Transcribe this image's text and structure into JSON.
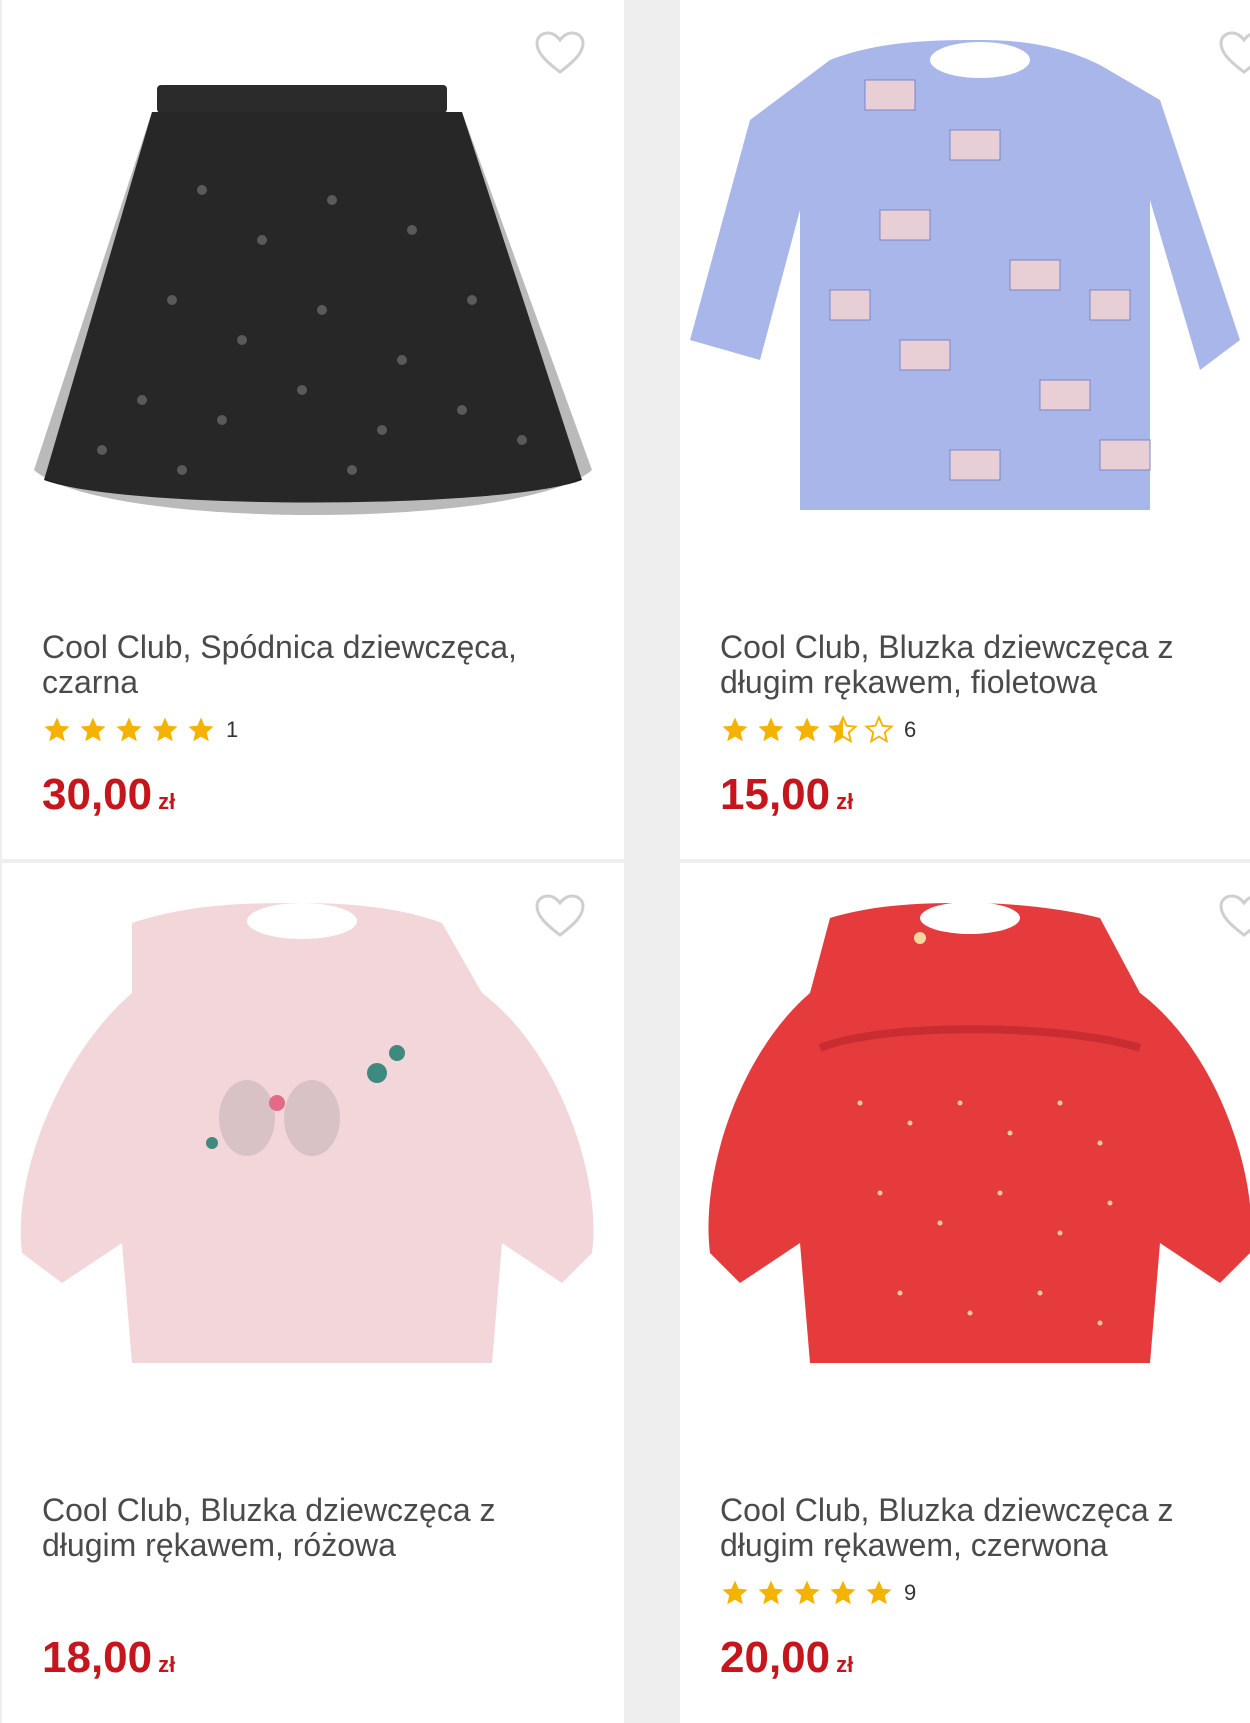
{
  "products": [
    {
      "title": "Cool Club, Spódnica dziewczęca, czarna",
      "stars": [
        1,
        1,
        1,
        1,
        1
      ],
      "rating_count": "1",
      "price": "30,00",
      "currency": "zł",
      "image_icon": "black-tulle-skirt-image"
    },
    {
      "title": "Cool Club, Bluzka dziewczęca z długim rękawem, fioletowa",
      "stars": [
        1,
        1,
        1,
        0.5,
        0
      ],
      "rating_count": "6",
      "price": "15,00",
      "currency": "zł",
      "image_icon": "blue-long-sleeve-blouse-image"
    },
    {
      "title": "Cool Club, Bluzka dziewczęca z długim rękawem, różowa",
      "stars": [],
      "rating_count": "",
      "price": "18,00",
      "currency": "zł",
      "image_icon": "pink-long-sleeve-blouse-image"
    },
    {
      "title": "Cool Club, Bluzka dziewczęca z długim rękawem, czerwona",
      "stars": [
        1,
        1,
        1,
        1,
        1
      ],
      "rating_count": "9",
      "price": "20,00",
      "currency": "zł",
      "image_icon": "red-long-sleeve-blouse-image"
    }
  ],
  "colors": {
    "price": "#c4161c",
    "star": "#f5b301",
    "heart_outline": "#cfcfcf"
  }
}
